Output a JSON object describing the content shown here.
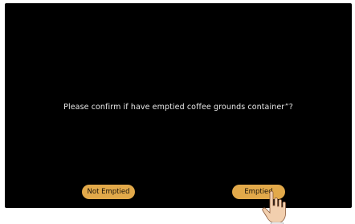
{
  "dialog": {
    "message": "Please confirm if have emptied coffee grounds container”?",
    "not_emptied_label": "Not Emptied",
    "emptied_label": "Emptied"
  },
  "colors": {
    "screen_background": "#000000",
    "button_fill": "#e2a94a",
    "button_text": "#1a1208",
    "message_text": "#e8e8e8"
  },
  "icons": {
    "pointer": "hand-pointer-icon"
  }
}
